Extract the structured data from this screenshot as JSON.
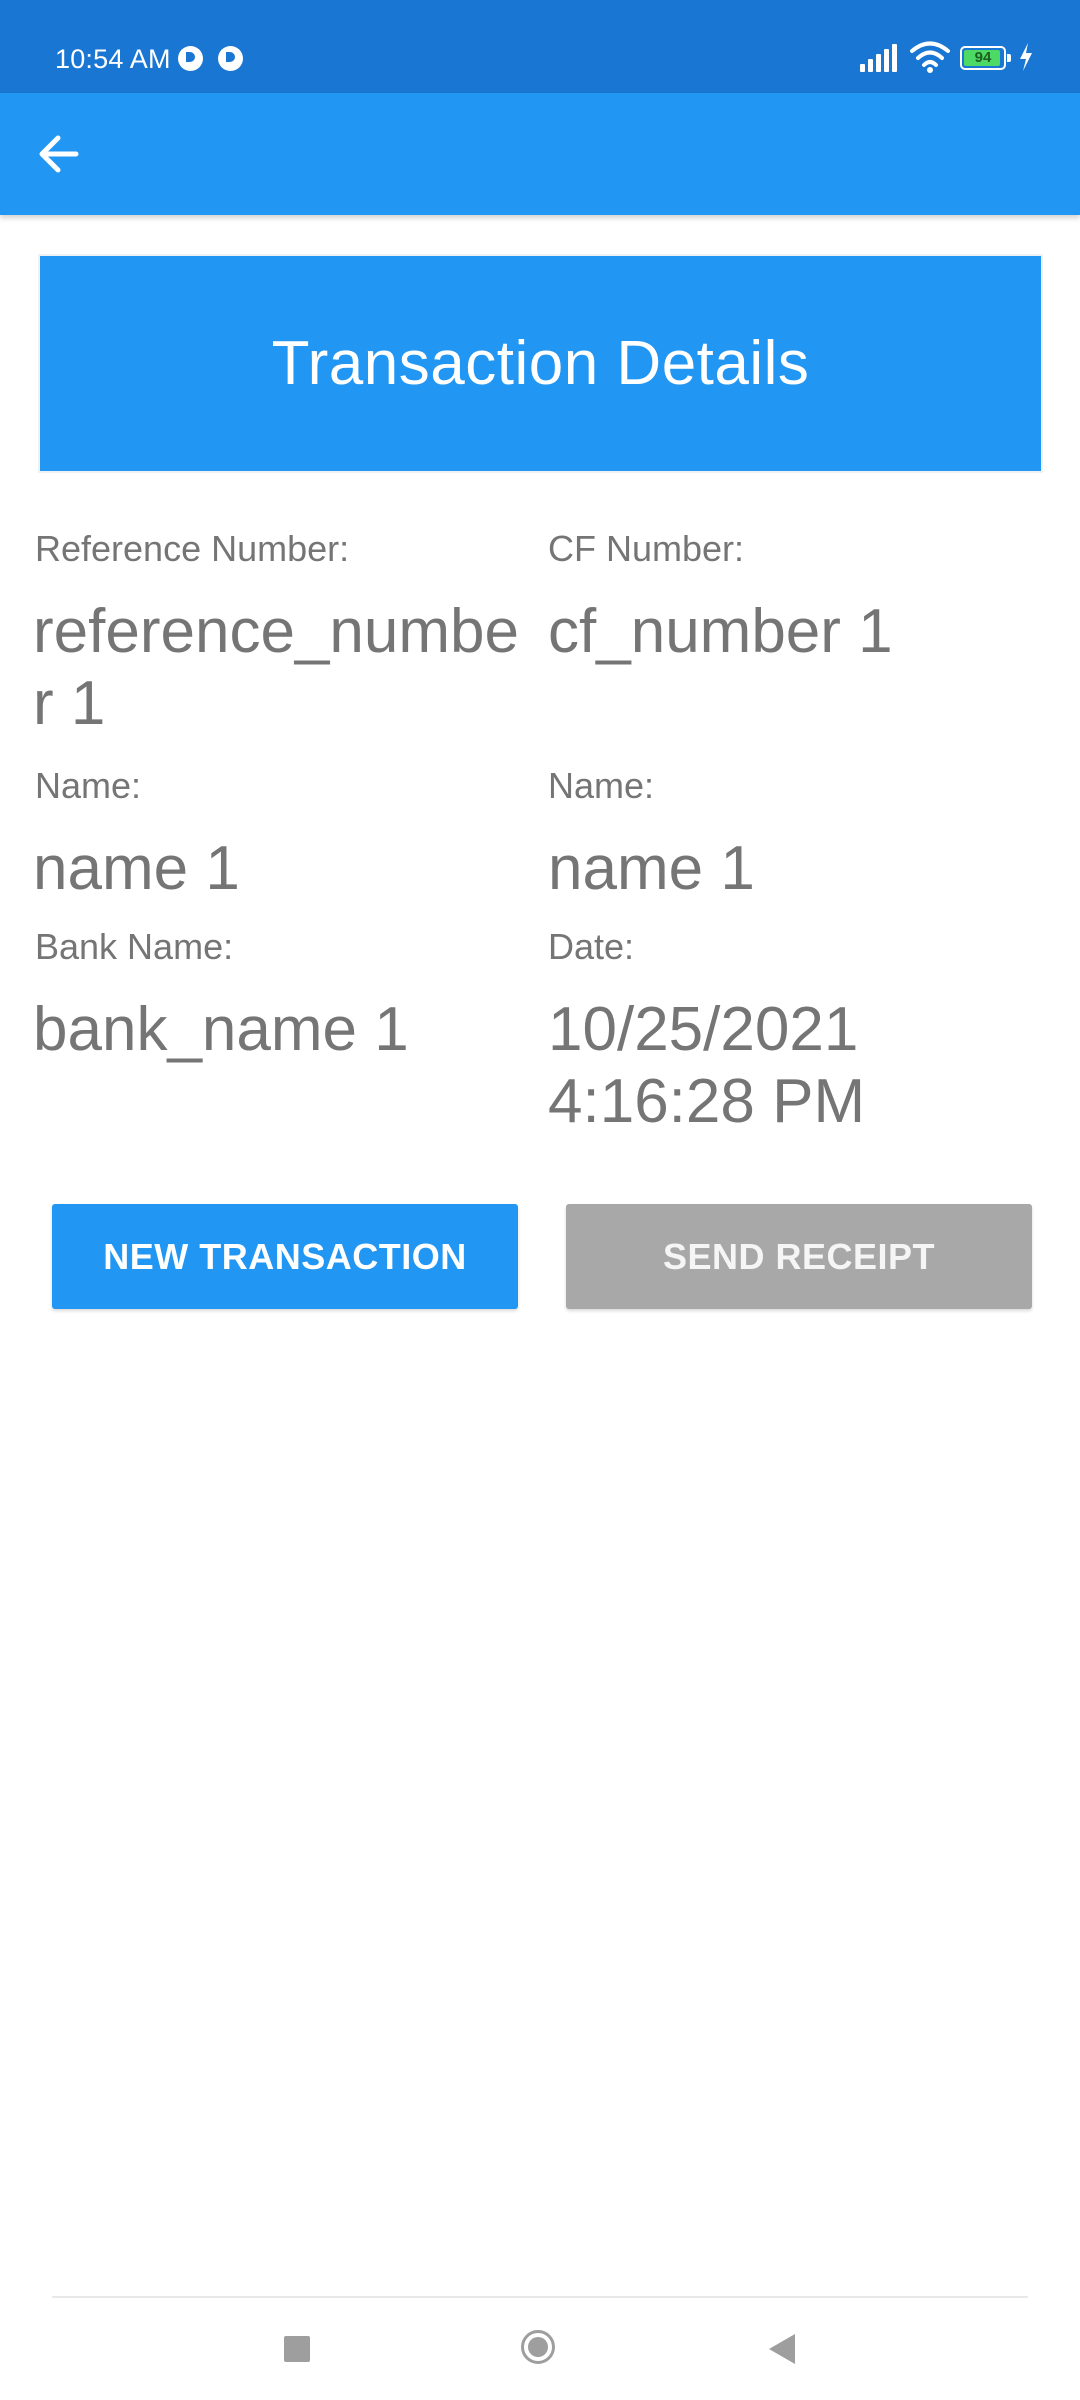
{
  "status_bar": {
    "time": "10:54 AM",
    "battery_level": "94",
    "battery_fraction": 0.94,
    "icons": [
      "app-notification-icon",
      "app-notification-icon",
      "signal-icon",
      "wifi-icon",
      "battery-icon",
      "charging-icon"
    ]
  },
  "app_bar": {
    "back_icon": "arrow-left-icon"
  },
  "header": {
    "title": "Transaction Details"
  },
  "fields": {
    "reference_number": {
      "label": "Reference Number:",
      "value": "reference_number 1"
    },
    "cf_number": {
      "label": "CF Number:",
      "value": "cf_number 1"
    },
    "name_left": {
      "label": "Name:",
      "value": "name 1"
    },
    "name_right": {
      "label": "Name:",
      "value": "name 1"
    },
    "bank_name": {
      "label": "Bank Name:",
      "value": "bank_name 1"
    },
    "date": {
      "label": "Date:",
      "value": "10/25/2021 4:16:28 PM"
    }
  },
  "actions": {
    "new_transaction": "NEW TRANSACTION",
    "send_receipt": "SEND RECEIPT"
  },
  "nav_bar": {
    "icons": [
      "recents-icon",
      "home-icon",
      "back-icon"
    ]
  },
  "colors": {
    "status_bar": "#1976d2",
    "primary": "#2196f3",
    "text_secondary": "#757575",
    "button_disabled": "#a8a8a8"
  }
}
